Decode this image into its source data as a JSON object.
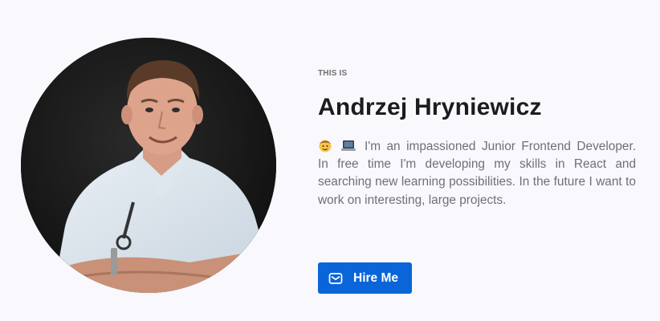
{
  "hero": {
    "eyebrow": "THIS IS",
    "name": "Andrzej Hryniewicz",
    "bio_emojis": [
      "student-face-icon",
      "laptop-icon"
    ],
    "bio": "I'm an impassioned Junior Frontend Developer. In free time I'm developing my skills in React and searching new learning possibilities. In the future I want to work on interesting, large projects.",
    "cta_label": "Hire Me",
    "cta_icon": "mail-icon"
  },
  "colors": {
    "background": "#f9f8fc",
    "accent": "#0a66d8",
    "heading": "#1c1c1e",
    "body_text": "#6f6f78"
  }
}
